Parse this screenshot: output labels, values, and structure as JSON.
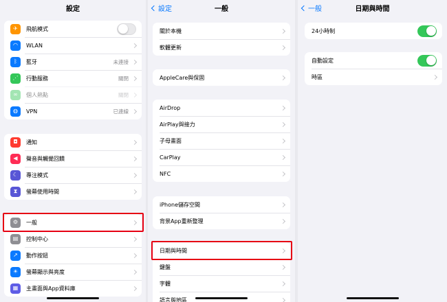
{
  "settings": {
    "title": "設定",
    "group1": [
      {
        "icon": "airplane-icon",
        "glyph": "✈",
        "color": "#ff9500",
        "label": "飛航模式",
        "toggle": "off"
      },
      {
        "icon": "wifi-icon",
        "glyph": "◠",
        "color": "#0a7aff",
        "label": "WLAN",
        "value": ""
      },
      {
        "icon": "bluetooth-icon",
        "glyph": "ᛒ",
        "color": "#0a7aff",
        "label": "藍牙",
        "value": "未連接"
      },
      {
        "icon": "cellular-icon",
        "glyph": "⋰",
        "color": "#34c759",
        "label": "行動服務",
        "value": "關閉"
      },
      {
        "icon": "hotspot-icon",
        "glyph": "∞",
        "color": "#34c759",
        "label": "個人熱點",
        "value": "關閉",
        "dim": true
      },
      {
        "icon": "vpn-icon",
        "glyph": "◍",
        "color": "#0a7aff",
        "label": "VPN",
        "value": "已連線"
      }
    ],
    "group2": [
      {
        "icon": "notifications-icon",
        "glyph": "◘",
        "color": "#ff3b30",
        "label": "通知"
      },
      {
        "icon": "sounds-icon",
        "glyph": "◀",
        "color": "#ff2d55",
        "label": "聲音與觸覺回饋"
      },
      {
        "icon": "focus-icon",
        "glyph": "☾",
        "color": "#5856d6",
        "label": "專注模式"
      },
      {
        "icon": "screen-time-icon",
        "glyph": "⧗",
        "color": "#5856d6",
        "label": "螢幕使用時間"
      }
    ],
    "group3": [
      {
        "icon": "gear-icon",
        "glyph": "⚙",
        "color": "#8e8e93",
        "label": "一般"
      },
      {
        "icon": "control-center-icon",
        "glyph": "▤",
        "color": "#8e8e93",
        "label": "控制中心"
      },
      {
        "icon": "action-button-icon",
        "glyph": "↗",
        "color": "#0a7aff",
        "label": "動作按鈕"
      },
      {
        "icon": "display-brightness-icon",
        "glyph": "☀",
        "color": "#0a7aff",
        "label": "螢幕顯示與亮度"
      },
      {
        "icon": "home-screen-icon",
        "glyph": "▦",
        "color": "#5e5ce6",
        "label": "主畫面與App資料庫"
      }
    ]
  },
  "general": {
    "back": "設定",
    "title": "一般",
    "group1": [
      {
        "label": "關於本機"
      },
      {
        "label": "軟體更新"
      }
    ],
    "group2": [
      {
        "label": "AppleCare與保固"
      }
    ],
    "group3": [
      {
        "label": "AirDrop"
      },
      {
        "label": "AirPlay與接力"
      },
      {
        "label": "子母畫面"
      },
      {
        "label": "CarPlay"
      },
      {
        "label": "NFC"
      }
    ],
    "group4": [
      {
        "label": "iPhone儲存空間"
      },
      {
        "label": "背景App重新整理"
      }
    ],
    "group5": [
      {
        "label": "日期與時間"
      },
      {
        "label": "鍵盤"
      },
      {
        "label": "字體"
      },
      {
        "label": "語言與地區"
      }
    ]
  },
  "datetime": {
    "back": "一般",
    "title": "日期與時間",
    "group1": [
      {
        "label": "24小時制",
        "toggle": "on"
      }
    ],
    "group2": [
      {
        "label": "自動設定",
        "toggle": "on"
      },
      {
        "label": "時區"
      }
    ]
  }
}
